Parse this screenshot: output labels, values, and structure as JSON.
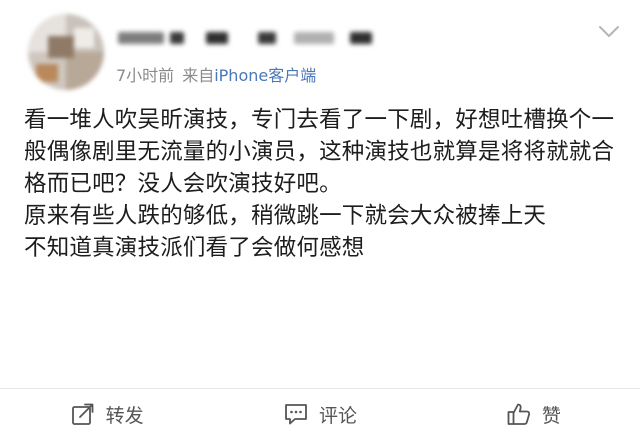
{
  "post": {
    "meta": {
      "time": "7小时前",
      "source_prefix": "来自",
      "source_device": "iPhone客户端"
    },
    "content": [
      "看一堆人吹吴昕演技，专门去看了一下剧，好想吐槽换个一般偶像剧里无流量的小演员，这种演技也就算是将将就就合格而已吧？没人会吹演技好吧。",
      "原来有些人跌的够低，稍微跳一下就会大众被捧上天",
      "不知道真演技派们看了会做何感想"
    ],
    "actions": {
      "repost_label": "转发",
      "comment_label": "评论",
      "like_label": "赞"
    },
    "icons": {
      "expand": "chevron-down-icon",
      "repost": "repost-icon",
      "comment": "comment-icon",
      "like": "thumbs-up-icon"
    },
    "colors": {
      "text": "#1d1d1d",
      "meta": "#8a8a8a",
      "link": "#4a78b8",
      "action": "#555555",
      "divider": "#e8e8e8"
    }
  }
}
